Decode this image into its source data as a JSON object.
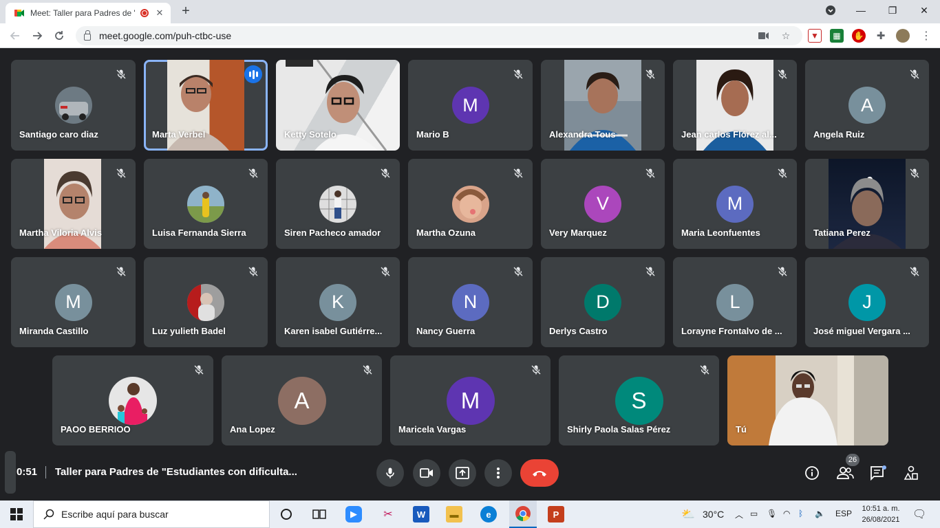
{
  "browser": {
    "tab_title": "Meet: Taller para Padres de \"",
    "url": "meet.google.com/puh-ctbc-use"
  },
  "participants_row1": [
    {
      "name": "Santiago caro diaz",
      "kind": "photo"
    },
    {
      "name": "Marta Verbel",
      "kind": "video",
      "speaking": true
    },
    {
      "name": "Ketty Sotelo",
      "kind": "video"
    },
    {
      "name": "Mario B",
      "kind": "initial",
      "initial": "M",
      "color": "#5e35b1"
    },
    {
      "name": "Alexandra Tous",
      "kind": "video"
    },
    {
      "name": "Jean carlos Flórez al...",
      "kind": "video"
    },
    {
      "name": "Angela Ruiz",
      "kind": "initial",
      "initial": "A",
      "color": "#78909c"
    }
  ],
  "participants_row2": [
    {
      "name": "Martha Viloria Alvis",
      "kind": "video"
    },
    {
      "name": "Luisa Fernanda Sierra",
      "kind": "photo"
    },
    {
      "name": "Siren Pacheco amador",
      "kind": "photo"
    },
    {
      "name": "Martha Ozuna",
      "kind": "photo"
    },
    {
      "name": "Very Marquez",
      "kind": "initial",
      "initial": "V",
      "color": "#ab47bc"
    },
    {
      "name": "Maria Leonfuentes",
      "kind": "initial",
      "initial": "M",
      "color": "#5c6bc0"
    },
    {
      "name": "Tatiana Perez",
      "kind": "video"
    }
  ],
  "participants_row3": [
    {
      "name": "Miranda Castillo",
      "kind": "initial",
      "initial": "M",
      "color": "#78909c"
    },
    {
      "name": "Luz yulieth Badel",
      "kind": "photo"
    },
    {
      "name": "Karen isabel Gutiérre...",
      "kind": "initial",
      "initial": "K",
      "color": "#78909c"
    },
    {
      "name": "Nancy Guerra",
      "kind": "initial",
      "initial": "N",
      "color": "#5c6bc0"
    },
    {
      "name": "Derlys Castro",
      "kind": "initial",
      "initial": "D",
      "color": "#00796b"
    },
    {
      "name": "Lorayne Frontalvo de ...",
      "kind": "initial",
      "initial": "L",
      "color": "#78909c"
    },
    {
      "name": "José miguel Vergara ...",
      "kind": "initial",
      "initial": "J",
      "color": "#0097a7"
    }
  ],
  "participants_row4": [
    {
      "name": "PAOO BERRIOO",
      "kind": "photo"
    },
    {
      "name": "Ana Lopez",
      "kind": "initial",
      "initial": "A",
      "color": "#8d6e63"
    },
    {
      "name": "Maricela Vargas",
      "kind": "initial",
      "initial": "M",
      "color": "#5e35b1"
    },
    {
      "name": "Shirly Paola Salas Pérez",
      "kind": "initial",
      "initial": "S",
      "color": "#00897b"
    },
    {
      "name": "Tú",
      "kind": "video",
      "self": true
    }
  ],
  "meeting": {
    "time": "0:51",
    "title": "Taller para Padres de \"Estudiantes con dificulta...",
    "participant_count": "26"
  },
  "taskbar": {
    "search_placeholder": "Escribe aquí para buscar",
    "temperature": "30°C",
    "language": "ESP",
    "time": "10:51 a. m.",
    "date": "26/08/2021"
  }
}
